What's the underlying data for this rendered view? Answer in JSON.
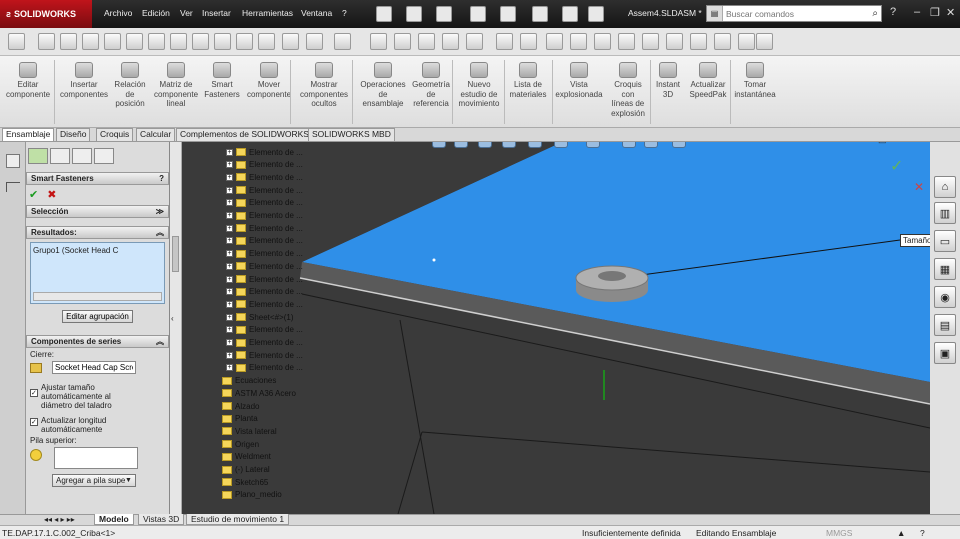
{
  "titlebar": {
    "logo": "SOLIDWORKS",
    "menus": [
      "Archivo",
      "Edición",
      "Ver",
      "Insertar",
      "Herramientas",
      "Ventana",
      "?"
    ],
    "doc_title": "Assem4.SLDASM *",
    "search_placeholder": "Buscar comandos",
    "help": "?"
  },
  "commands": [
    {
      "label": "Editar\ncomponente"
    },
    {
      "label": "Insertar\ncomponentes"
    },
    {
      "label": "Relación\nde\nposición"
    },
    {
      "label": "Matriz de\ncomponente\nlineal"
    },
    {
      "label": "Smart\nFasteners"
    },
    {
      "label": "Mover\ncomponente"
    },
    {
      "label": "Mostrar\ncomponentes\nocultos"
    },
    {
      "label": "Operaciones\nde\nensamblaje"
    },
    {
      "label": "Geometría\nde\nreferencia"
    },
    {
      "label": "Nuevo\nestudio de\nmovimiento"
    },
    {
      "label": "Lista de\nmateriales"
    },
    {
      "label": "Vista\nexplosionada"
    },
    {
      "label": "Croquis\ncon\nlíneas de\nexplosión"
    },
    {
      "label": "Instant\n3D"
    },
    {
      "label": "Actualizar\nSpeedPak"
    },
    {
      "label": "Tomar\ninstantánea"
    }
  ],
  "tabs": [
    "Ensamblaje",
    "Diseño",
    "Croquis",
    "Calcular",
    "Complementos de SOLIDWORKS",
    "SOLIDWORKS MBD"
  ],
  "property_manager": {
    "title": "Smart Fasteners",
    "help": "?",
    "ok": "✔",
    "cancel": "✖",
    "selection_header": "Selección",
    "results_header": "Resultados:",
    "results_item": "Grupo1 (Socket Head C",
    "edit_group_btn": "Editar agrupación",
    "series_header": "Componentes de series",
    "fastener_label": "Cierre:",
    "fastener_value": "Socket Head Cap Scre",
    "auto_size_label": "Ajustar tamaño automáticamente al diámetro del taladro",
    "auto_length_label": "Actualizar longitud automáticamente",
    "top_stack_label": "Pila superior:",
    "add_stack_btn": "Agregar a pila supe"
  },
  "tree": [
    "Elemento de ...",
    "Elemento de ...",
    "Elemento de ...",
    "Elemento de ...",
    "Elemento de ...",
    "Elemento de ...",
    "Elemento de ...",
    "Elemento de ...",
    "Elemento de ...",
    "Elemento de ...",
    "Elemento de ...",
    "Elemento de ...",
    "Elemento de ...",
    "Sheet<#>(1)",
    "Elemento de ...",
    "Elemento de ...",
    "Elemento de ...",
    "Elemento de ...",
    "Ecuaciones",
    "ASTM A36 Acero",
    "Alzado",
    "Planta",
    "Vista lateral",
    "Origen",
    "Weldment",
    "(-) Lateral",
    "Sketch65",
    "Plano_medio"
  ],
  "viewport": {
    "callout": "Tamaño"
  },
  "bottom_tabs": [
    "Modelo",
    "Vistas 3D",
    "Estudio de movimiento 1"
  ],
  "status": {
    "file": "TE.DAP.17.1.C.002_Criba<1>",
    "definition": "Insuficientemente definida",
    "mode": "Editando Ensamblaje",
    "units": "MMGS"
  },
  "colors": {
    "viewport_blue": "#2f8fe8",
    "steel_dark": "#353535",
    "titlebar": "#1e1e1e",
    "logo_red": "#b5121b"
  },
  "icons": [
    "solidworks-logo-icon",
    "search-icon",
    "home-icon",
    "folder-icon",
    "ok-check-icon",
    "cancel-x-icon"
  ]
}
